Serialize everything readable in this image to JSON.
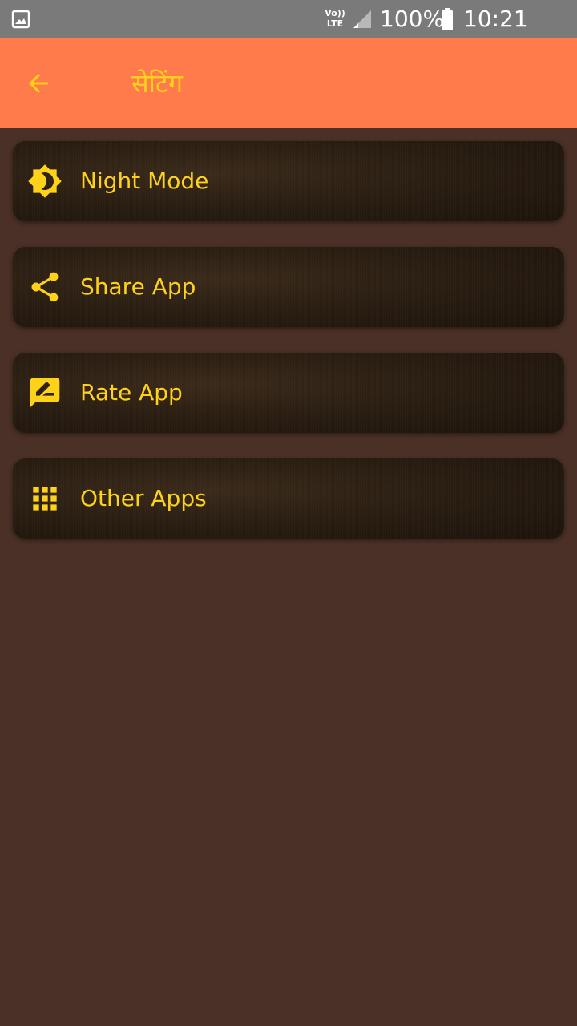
{
  "status_bar": {
    "network_label": "Vo)) LTE",
    "battery": "100%",
    "time": "10:21 p.m.",
    "icons": [
      "gallery-icon",
      "signal-icon",
      "battery-icon"
    ]
  },
  "app_bar": {
    "title": "सेटिंग",
    "back_icon": "arrow-left-icon"
  },
  "settings": {
    "items": [
      {
        "label": "Night Mode",
        "icon": "night-mode-icon"
      },
      {
        "label": "Share App",
        "icon": "share-icon"
      },
      {
        "label": "Rate App",
        "icon": "rate-icon"
      },
      {
        "label": "Other Apps",
        "icon": "apps-grid-icon"
      }
    ]
  },
  "colors": {
    "status_bar": "#7a7a7a",
    "app_bar": "#ff7b4b",
    "accent": "#ffd21a",
    "background": "#4a3026",
    "card": "#2a1e12"
  }
}
